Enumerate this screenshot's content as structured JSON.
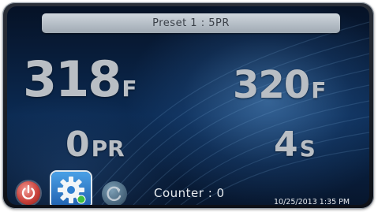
{
  "preset": {
    "label": "Preset 1 : 5PR"
  },
  "readings": {
    "temp_left": {
      "value": "318",
      "unit": "F"
    },
    "temp_right": {
      "value": "320",
      "unit": "F"
    },
    "pressure_count": {
      "value": "0",
      "unit": "PR"
    },
    "time": {
      "value": "4",
      "unit": "S"
    }
  },
  "footer": {
    "counter": "Counter : 0",
    "datetime": "10/25/2013 1:35 PM"
  },
  "icons": {
    "power": "power-icon",
    "settings": "gear-icon",
    "refresh": "refresh-icon"
  },
  "colors": {
    "power": "#c9423b",
    "settings": "#2f7fd0",
    "refresh": "#55748a"
  }
}
